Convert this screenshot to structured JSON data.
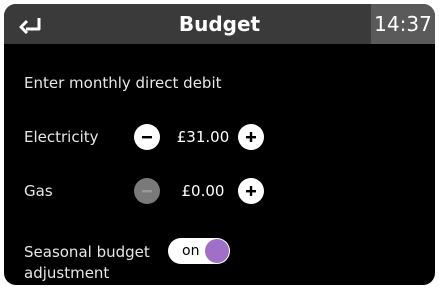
{
  "header": {
    "title": "Budget",
    "time": "14:37"
  },
  "form": {
    "instruction": "Enter monthly direct debit",
    "rows": [
      {
        "label": "Electricity",
        "value": "£31.00",
        "minus_enabled": true,
        "plus_enabled": true
      },
      {
        "label": "Gas",
        "value": "£0.00",
        "minus_enabled": false,
        "plus_enabled": true
      }
    ],
    "seasonal": {
      "label_line1": "Seasonal budget",
      "label_line2": "adjustment",
      "toggle_label": "on",
      "state": true
    }
  },
  "icons": {
    "back": "back-arrow-icon",
    "minus": "minus-icon",
    "plus": "plus-icon"
  },
  "colors": {
    "header_bg": "#3a3a3a",
    "time_bg": "#5a5a5a",
    "toggle_knob": "#a070c8",
    "disabled_button": "#7a7a7a"
  }
}
